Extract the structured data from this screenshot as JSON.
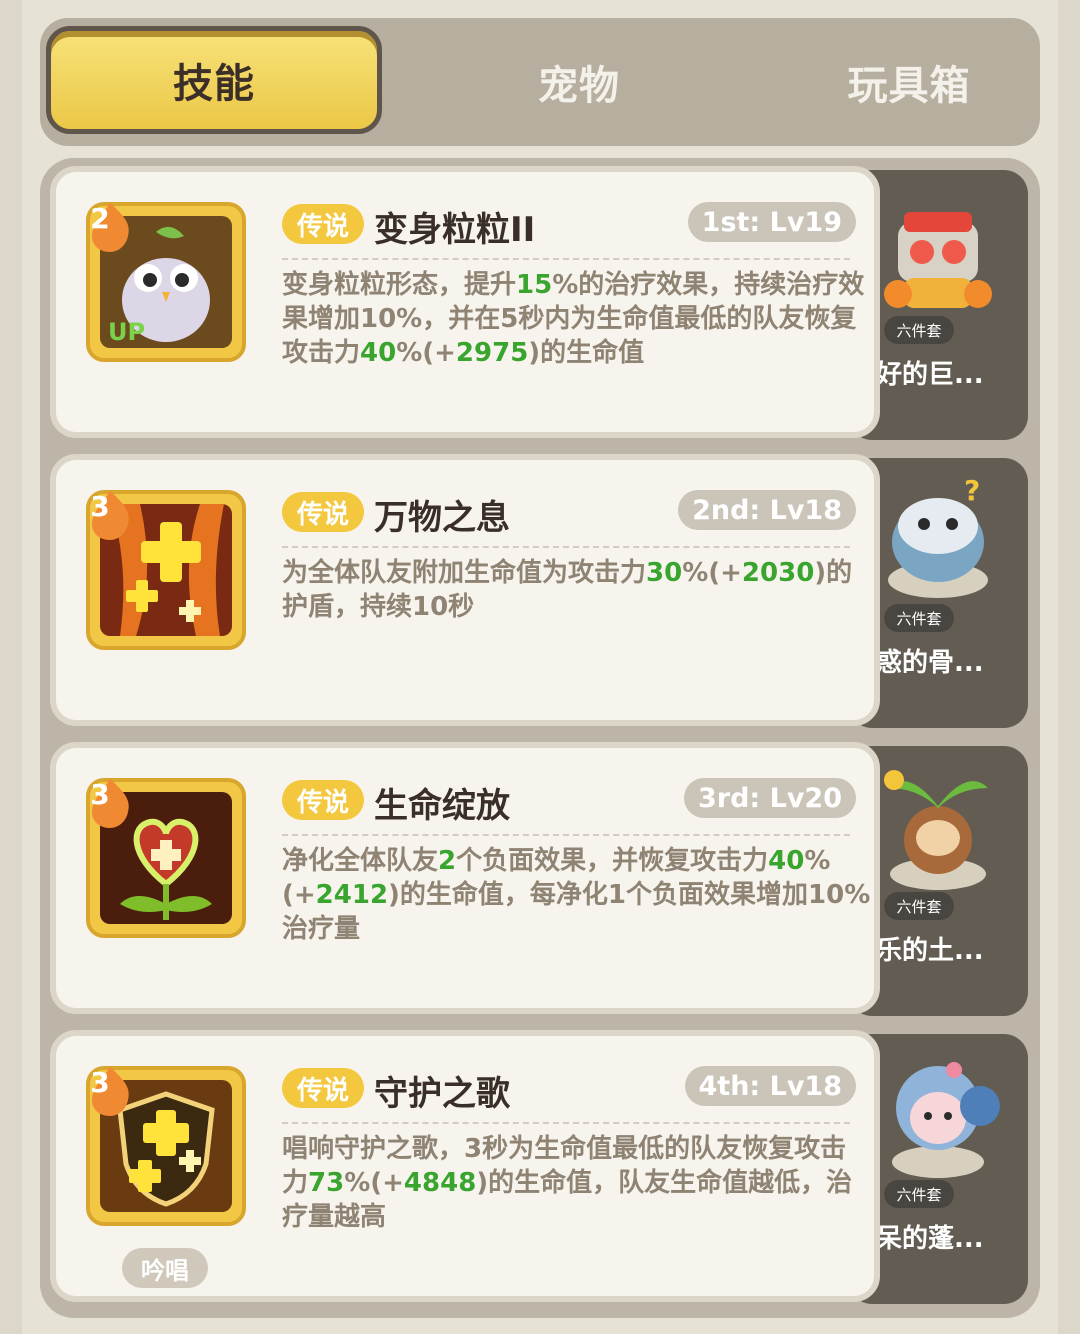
{
  "tabs": [
    {
      "label": "技能",
      "active": true
    },
    {
      "label": "宠物",
      "active": false
    },
    {
      "label": "玩具箱",
      "active": false
    }
  ],
  "skills": [
    {
      "level": "2",
      "icon": "owl-icon",
      "icon_badge": "UP",
      "rarity": "传说",
      "name": "变身粒粒II",
      "rank": "1st: Lv19",
      "desc_parts": [
        "变身粒粒形态，提升",
        "15",
        "%的治疗效果，持续治疗效果增加10%，并在5秒内为生命值最低的队友恢复攻击力",
        "40",
        "%(+",
        "2975",
        ")的生命值"
      ],
      "pet": {
        "badge": "六件套",
        "name": "友好的巨...",
        "icon": "robot-pet-icon"
      }
    },
    {
      "level": "3",
      "icon": "healing-plus-icon",
      "rarity": "传说",
      "name": "万物之息",
      "rank": "2nd: Lv18",
      "desc_parts": [
        "为全体队友附加生命值为攻击力",
        "30",
        "%(+",
        "2030",
        ")的护盾，持续10秒"
      ],
      "pet": {
        "badge": "六件套",
        "name": "困惑的骨...",
        "icon": "dino-pet-icon"
      }
    },
    {
      "level": "3",
      "icon": "heart-flower-icon",
      "rarity": "传说",
      "name": "生命绽放",
      "rank": "3rd: Lv20",
      "desc_parts": [
        "净化全体队友",
        "2",
        "个负面效果，并恢复攻击力",
        "40",
        "%(+",
        "2412",
        ")的生命值，每净化1个负面效果增加10%治疗量"
      ],
      "pet": {
        "badge": "六件套",
        "name": "快乐的土...",
        "icon": "sprout-pet-icon"
      }
    },
    {
      "level": "3",
      "icon": "shield-heal-icon",
      "rarity": "传说",
      "name": "守护之歌",
      "rank": "4th: Lv18",
      "chant": "吟唱",
      "desc_parts": [
        "唱响守护之歌，3秒为生命值最低的队友恢复攻击力",
        "73",
        "%(+",
        "4848",
        ")的生命值，队友生命值越低，治疗量越高"
      ],
      "pet": {
        "badge": "六件套",
        "name": "发呆的蓬...",
        "icon": "sheep-pet-icon"
      }
    }
  ]
}
